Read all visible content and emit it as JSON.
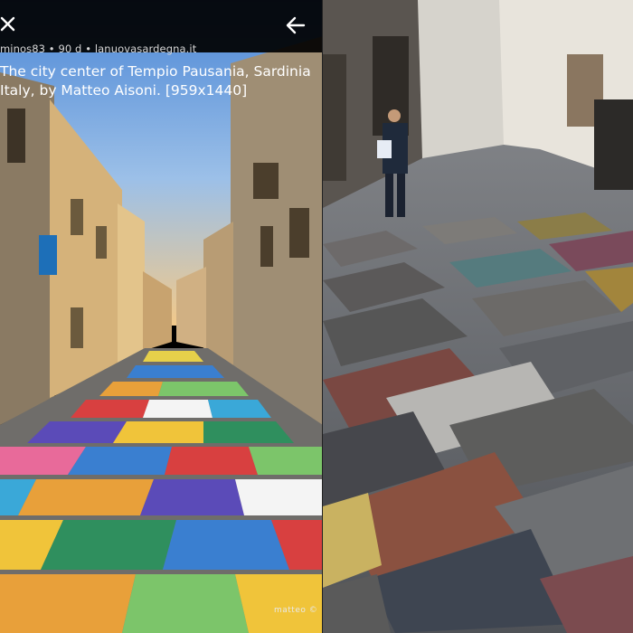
{
  "viewer": {
    "close_icon": "close-icon",
    "back_icon": "arrow-left-icon",
    "meta": {
      "user": "minos83",
      "separator1": " • ",
      "age": "90 d",
      "separator2": " • ",
      "domain": "lanuovasardegna.it"
    },
    "title_line1": "The city center of Tempio Pausania, Sardinia",
    "title_line2": "Italy, by Matteo Aisoni. [959x1440]",
    "watermark": "matteo ©"
  },
  "colors": {
    "overlay": "#000000",
    "text": "#ffffff",
    "meta_text": "#d7d7d7"
  }
}
